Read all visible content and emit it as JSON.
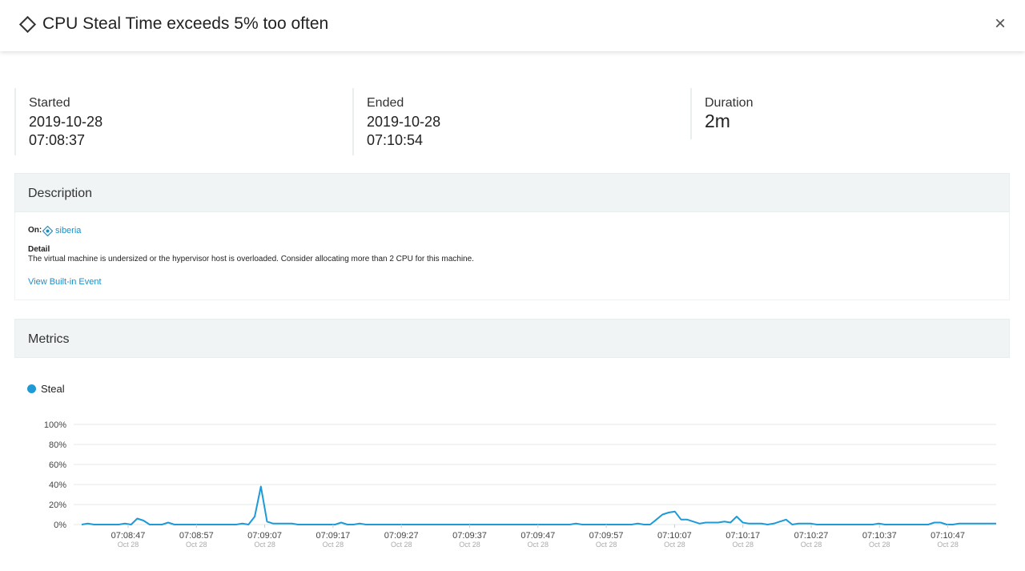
{
  "header": {
    "title": "CPU Steal Time exceeds 5% too often",
    "close_glyph": "×",
    "icon": "diamond-icon"
  },
  "stats": {
    "started": {
      "label": "Started",
      "date": "2019-10-28",
      "time": "07:08:37"
    },
    "ended": {
      "label": "Ended",
      "date": "2019-10-28",
      "time": "07:10:54"
    },
    "duration": {
      "label": "Duration",
      "value": "2m"
    }
  },
  "description": {
    "heading": "Description",
    "on_label": "On:",
    "host": "siberia",
    "host_icon": "host-icon",
    "detail_heading": "Detail",
    "detail_text": "The virtual machine is undersized or the hypervisor host is overloaded. Consider allocating more than 2 CPU for this machine.",
    "link": "View Built-in Event"
  },
  "metrics": {
    "heading": "Metrics",
    "legend": "Steal",
    "color": "#1e9ad8"
  },
  "chart_data": {
    "type": "line",
    "series": [
      {
        "name": "Steal",
        "color": "#1e9ad8"
      }
    ],
    "y_ticks": [
      "100%",
      "80%",
      "60%",
      "40%",
      "20%",
      "0%"
    ],
    "ylim": [
      0,
      100
    ],
    "x_ticks": [
      {
        "time": "07:08:47",
        "date": "Oct 28"
      },
      {
        "time": "07:08:57",
        "date": "Oct 28"
      },
      {
        "time": "07:09:07",
        "date": "Oct 28"
      },
      {
        "time": "07:09:17",
        "date": "Oct 28"
      },
      {
        "time": "07:09:27",
        "date": "Oct 28"
      },
      {
        "time": "07:09:37",
        "date": "Oct 28"
      },
      {
        "time": "07:09:47",
        "date": "Oct 28"
      },
      {
        "time": "07:09:57",
        "date": "Oct 28"
      },
      {
        "time": "07:10:07",
        "date": "Oct 28"
      },
      {
        "time": "07:10:17",
        "date": "Oct 28"
      },
      {
        "time": "07:10:27",
        "date": "Oct 28"
      },
      {
        "time": "07:10:37",
        "date": "Oct 28"
      },
      {
        "time": "07:10:47",
        "date": "Oct 28"
      }
    ],
    "x_seconds": [
      0,
      1,
      2,
      3,
      4,
      5,
      6,
      7,
      8,
      9,
      10,
      11,
      12,
      13,
      14,
      15,
      16,
      17,
      18,
      19,
      20,
      21,
      22,
      23,
      24,
      25,
      26,
      27,
      28,
      29,
      30,
      31,
      32,
      33,
      34,
      35,
      36,
      37,
      38,
      39,
      40,
      41,
      42,
      43,
      44,
      45,
      46,
      47,
      48,
      49,
      50,
      51,
      52,
      53,
      54,
      55,
      56,
      57,
      58,
      59,
      60,
      61,
      62,
      63,
      64,
      65,
      66,
      67,
      68,
      69,
      70,
      71,
      72,
      73,
      74,
      75,
      76,
      77,
      78,
      79,
      80,
      81,
      82,
      83,
      84,
      85,
      86,
      87,
      88,
      89,
      90,
      91,
      92,
      93,
      94,
      95,
      96,
      97,
      98,
      99,
      100,
      101,
      102,
      103,
      104,
      105,
      106,
      107,
      108,
      109,
      110,
      111,
      112,
      113,
      114,
      115,
      116,
      117,
      118,
      119,
      120,
      121,
      122,
      123,
      124,
      125,
      126,
      127,
      128,
      129,
      130,
      131,
      132,
      133,
      134,
      135
    ],
    "values": [
      0,
      1,
      0,
      0,
      0,
      0,
      0,
      1,
      0,
      6,
      4,
      0,
      0,
      0,
      2,
      0,
      0,
      0,
      0,
      0,
      0,
      0,
      0,
      0,
      0,
      0,
      1,
      0,
      8,
      38,
      3,
      1,
      1,
      1,
      1,
      0,
      0,
      0,
      0,
      0,
      0,
      0,
      2,
      0,
      0,
      1,
      0,
      0,
      0,
      0,
      0,
      0,
      0,
      0,
      0,
      0,
      0,
      0,
      0,
      0,
      0,
      0,
      0,
      0,
      0,
      0,
      0,
      0,
      0,
      0,
      0,
      0,
      0,
      0,
      0,
      0,
      0,
      0,
      0,
      0,
      1,
      0,
      0,
      0,
      0,
      0,
      0,
      0,
      0,
      0,
      1,
      0,
      0,
      5,
      10,
      12,
      13,
      5,
      5,
      3,
      1,
      2,
      2,
      2,
      3,
      2,
      8,
      2,
      1,
      1,
      1,
      0,
      1,
      3,
      5,
      0,
      1,
      1,
      1,
      0,
      0,
      0,
      0,
      0,
      0,
      0,
      0,
      0,
      0,
      1,
      0,
      0,
      0,
      0,
      0,
      0,
      0,
      0,
      2,
      2,
      0,
      0,
      1,
      1,
      1,
      1,
      1,
      1,
      1
    ],
    "x_start_label_index": 0
  }
}
